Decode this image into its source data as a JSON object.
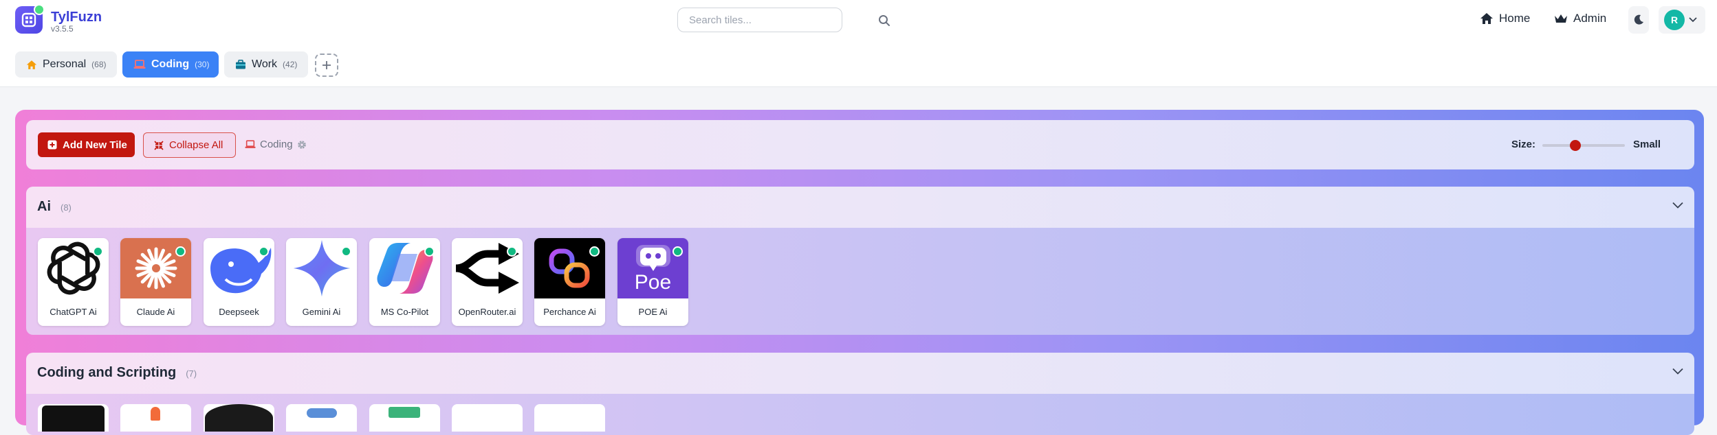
{
  "app": {
    "title": "TylFuzn",
    "version": "v3.5.5"
  },
  "search": {
    "placeholder": "Search tiles..."
  },
  "nav": {
    "home": "Home",
    "admin": "Admin"
  },
  "user": {
    "initial": "R"
  },
  "tabs": [
    {
      "label": "Personal",
      "count": "(68)",
      "icon": "home-icon",
      "active": false
    },
    {
      "label": "Coding",
      "count": "(30)",
      "icon": "laptop-icon",
      "active": true
    },
    {
      "label": "Work",
      "count": "(42)",
      "icon": "briefcase-icon",
      "active": false
    }
  ],
  "toolbar": {
    "add_label": "Add New Tile",
    "collapse_label": "Collapse All",
    "board_name": "Coding",
    "size_label": "Size:",
    "size_value": "Small",
    "size_level": 0.4
  },
  "groups": [
    {
      "title": "Ai",
      "count": "(8)",
      "tiles": [
        {
          "label": "ChatGPT Ai",
          "icon": "chatgpt-logo-icon"
        },
        {
          "label": "Claude Ai",
          "icon": "claude-logo-icon"
        },
        {
          "label": "Deepseek",
          "icon": "deepseek-whale-icon"
        },
        {
          "label": "Gemini Ai",
          "icon": "gemini-star-icon"
        },
        {
          "label": "MS Co-Pilot",
          "icon": "copilot-logo-icon"
        },
        {
          "label": "OpenRouter.ai",
          "icon": "openrouter-arrows-icon"
        },
        {
          "label": "Perchance Ai",
          "icon": "perchance-rings-icon"
        },
        {
          "label": "POE Ai",
          "icon": "poe-chat-icon",
          "logo_text": "Poe"
        }
      ]
    },
    {
      "title": "Coding and Scripting",
      "count": "(7)"
    }
  ],
  "colors": {
    "accent": "#3b82f6",
    "danger": "#c2170f",
    "status_online": "#10b981",
    "brand": "#4f46e5"
  }
}
